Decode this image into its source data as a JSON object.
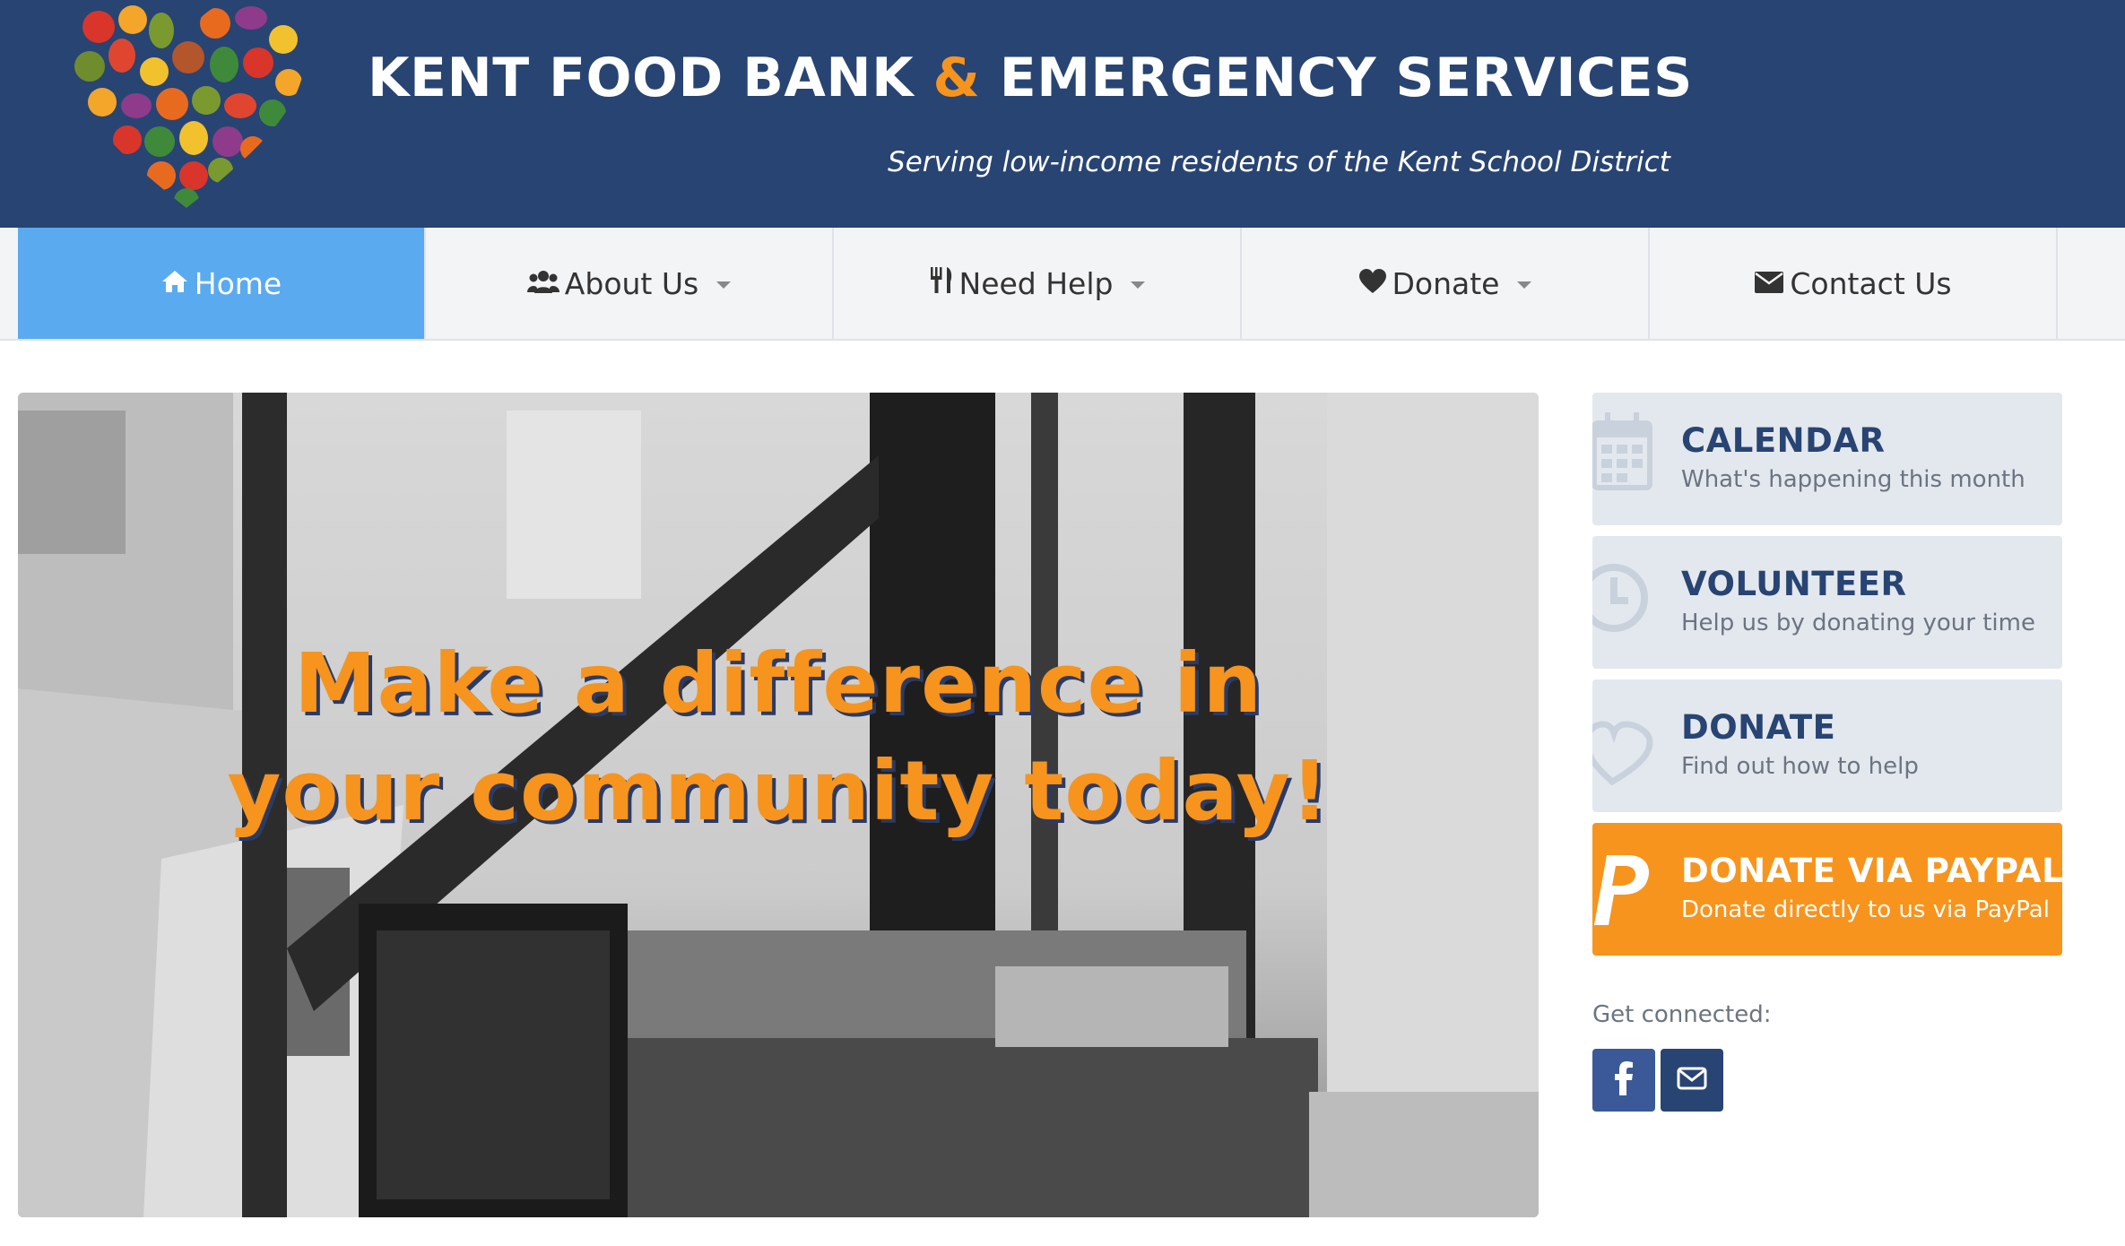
{
  "header": {
    "title_part1": "KENT FOOD BANK",
    "title_amp": "&",
    "title_part2": "EMERGENCY SERVICES",
    "tagline": "Serving low-income residents of the Kent School District"
  },
  "nav": {
    "items": [
      {
        "label": "Home",
        "icon": "home-icon",
        "active": true
      },
      {
        "label": "About Us",
        "icon": "users-icon",
        "dropdown": true
      },
      {
        "label": "Need Help",
        "icon": "utensils-icon",
        "dropdown": true
      },
      {
        "label": "Donate",
        "icon": "heart-icon",
        "dropdown": true
      },
      {
        "label": "Contact Us",
        "icon": "envelope-icon"
      }
    ]
  },
  "hero": {
    "headline": "Make a difference in your community today!"
  },
  "sidebar": {
    "cards": [
      {
        "title": "CALENDAR",
        "subtitle": "What's happening this month",
        "icon": "calendar-icon"
      },
      {
        "title": "VOLUNTEER",
        "subtitle": "Help us by donating your time",
        "icon": "clock-icon"
      },
      {
        "title": "DONATE",
        "subtitle": "Find out how to help",
        "icon": "heart-outline-icon"
      },
      {
        "title": "DONATE VIA PAYPAL",
        "subtitle": "Donate directly to us via PayPal",
        "icon": "paypal-icon"
      }
    ],
    "connect_label": "Get connected:",
    "social": [
      {
        "name": "facebook",
        "icon": "facebook-icon"
      },
      {
        "name": "email",
        "icon": "envelope-icon"
      }
    ]
  },
  "colors": {
    "header_bg": "#284472",
    "accent_orange": "#f7941d",
    "nav_active": "#5aaaef",
    "card_bg": "#e3e8ef"
  }
}
